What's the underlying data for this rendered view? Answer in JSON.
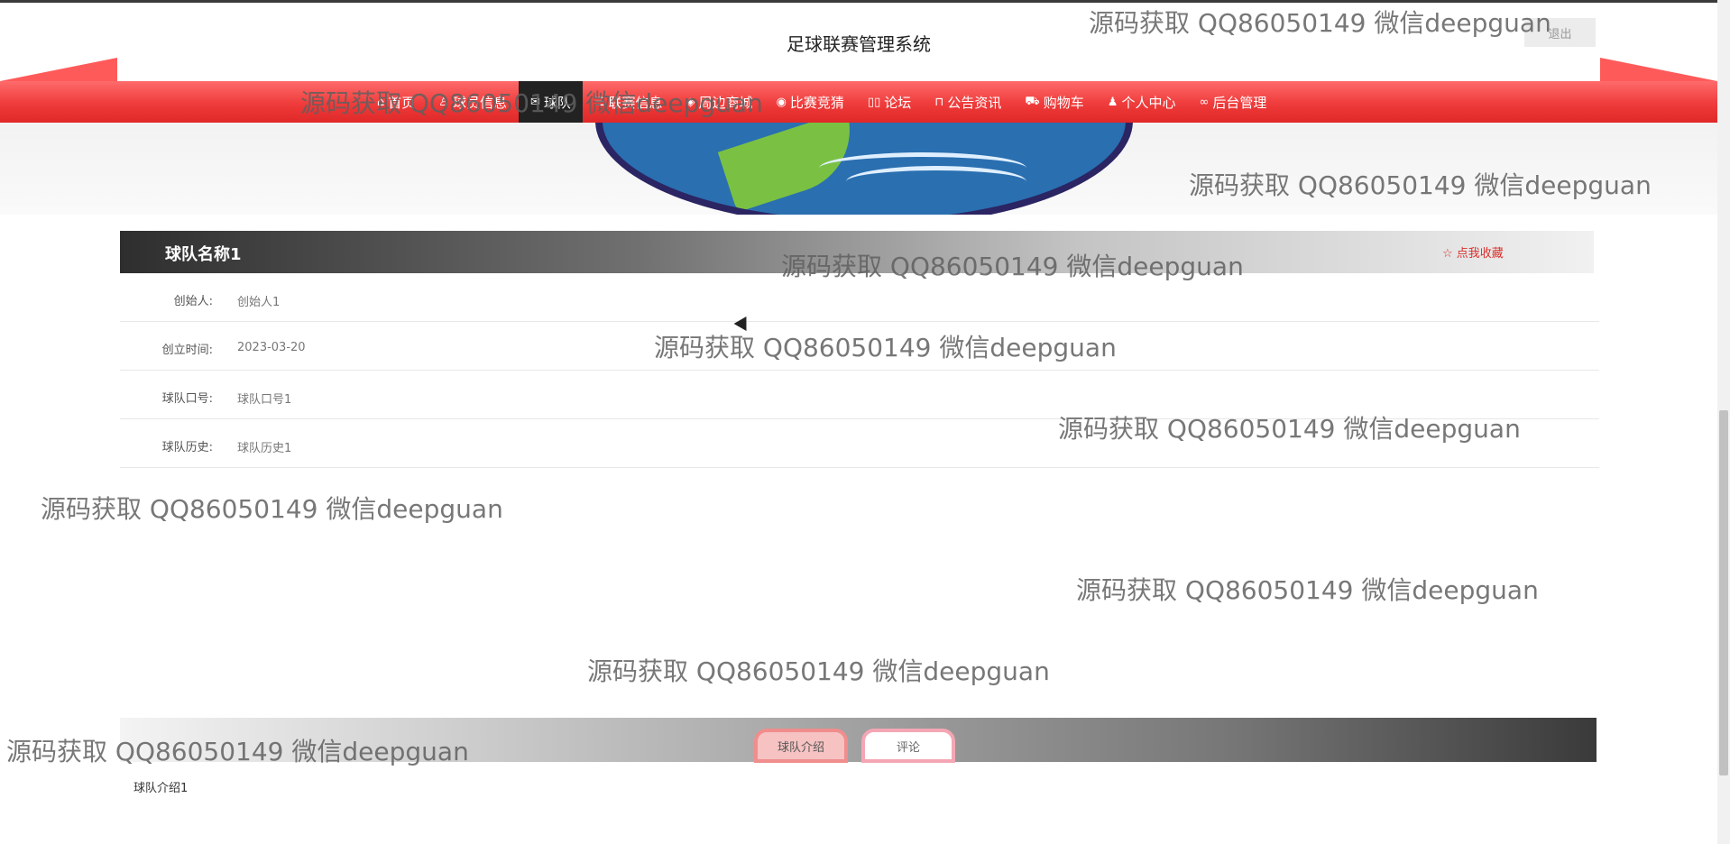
{
  "site": {
    "title": "足球联赛管理系统",
    "logout_label": "退出"
  },
  "nav": {
    "items": [
      {
        "label": "首页",
        "icon": "home-icon",
        "glyph": "⌂"
      },
      {
        "label": "球员信息",
        "icon": "user-icon",
        "glyph": "♙"
      },
      {
        "label": "球队",
        "icon": "mail-icon",
        "glyph": "✉",
        "active": true
      },
      {
        "label": "联赛信息",
        "icon": "list-icon",
        "glyph": "☰"
      },
      {
        "label": "周边商城",
        "icon": "shop-icon",
        "glyph": "◈"
      },
      {
        "label": "比赛竞猜",
        "icon": "palette-icon",
        "glyph": "◉"
      },
      {
        "label": "论坛",
        "icon": "book-icon",
        "glyph": "▯▯"
      },
      {
        "label": "公告资讯",
        "icon": "read-icon",
        "glyph": "⊓"
      },
      {
        "label": "购物车",
        "icon": "cart-icon",
        "glyph": "⛟"
      },
      {
        "label": "个人中心",
        "icon": "person-icon",
        "glyph": "♟"
      },
      {
        "label": "后台管理",
        "icon": "link-icon",
        "glyph": "∞"
      }
    ]
  },
  "team": {
    "name": "球队名称1",
    "favorite_label": "☆ 点我收藏",
    "fields": [
      {
        "label": "创始人:",
        "value": "创始人1"
      },
      {
        "label": "创立时间:",
        "value": "2023-03-20"
      },
      {
        "label": "球队口号:",
        "value": "球队口号1"
      },
      {
        "label": "球队历史:",
        "value": "球队历史1"
      }
    ]
  },
  "tabs": {
    "intro_label": "球队介绍",
    "comment_label": "评论",
    "intro_content": "球队介绍1"
  },
  "watermark": "源码获取 QQ86050149 微信deepguan"
}
